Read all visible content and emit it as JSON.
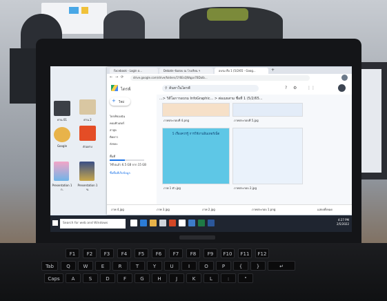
{
  "chrome": {
    "tabs": [
      {
        "label": "Facebook - Login o..."
      },
      {
        "label": "Debate ข้อสอบ ณ โรงเรียน ฯ"
      },
      {
        "label": "อบรม สื่อ 1 (5/2/65 - Goog..."
      }
    ],
    "url": "drive.google.com/drive/folders/1Y6EsQWqpx7BDalb..."
  },
  "drive": {
    "app_name": "ไดรฟ์",
    "search_placeholder": "ค้นหาในไดรฟ์",
    "new_button": "ใหม่",
    "breadcrumb": "...> วิดีโอการอบรม InfoGraphic... > ต่อเมธสาม ชื่อที่ 1 (5/2/65...",
    "sidebar": [
      {
        "label": "ไดรฟ์ของฉัน"
      },
      {
        "label": "คอมพิวเตอร์"
      },
      {
        "label": "ล่าสุด"
      },
      {
        "label": "ติดดาว"
      },
      {
        "label": "ถังขยะ"
      },
      {
        "label": "พื้นที่"
      },
      {
        "label": "ใช้ไปแล้ว 6.5 GB จาก 15 GB"
      },
      {
        "label": "ซื้อพื้นที่เก็บข้อมูล"
      }
    ],
    "files": [
      {
        "name": "ภาพประกอบที่ 4.png"
      },
      {
        "name": "ภาพประกอบที่ 5.jpg"
      },
      {
        "name": "ภาพ 1 ตัว.jpg"
      },
      {
        "name": "ภาพประกอบ 2.jpg"
      }
    ],
    "infographic_title": "5 เรื่องควรรู้ การใช้งานอินเทอร์เน็ต"
  },
  "downloads": [
    {
      "name": "ภาพ 4.jpg"
    },
    {
      "name": "ภาพ 3.jpg"
    },
    {
      "name": "ภาพ 2.jpg"
    },
    {
      "name": "ภาพประกอบ 1.png"
    }
  ],
  "downloads_show_all": "แสดงทั้งหมด",
  "desktop": {
    "files": [
      {
        "name": "ด่าน 01"
      },
      {
        "name": "ด่าน 2"
      },
      {
        "name": "Google"
      },
      {
        "name": "ตัวอย่าง"
      },
      {
        "name": "Presentation 1 ก."
      },
      {
        "name": "Presentation 1 ข."
      }
    ]
  },
  "taskbar": {
    "search_placeholder": "Search for web and Windows",
    "time": "4:27 PM",
    "date": "2/5/2022"
  },
  "colors": {
    "drive_blue": "#1a73e8",
    "taskbar": "#1f2530",
    "bezel": "#141518"
  }
}
